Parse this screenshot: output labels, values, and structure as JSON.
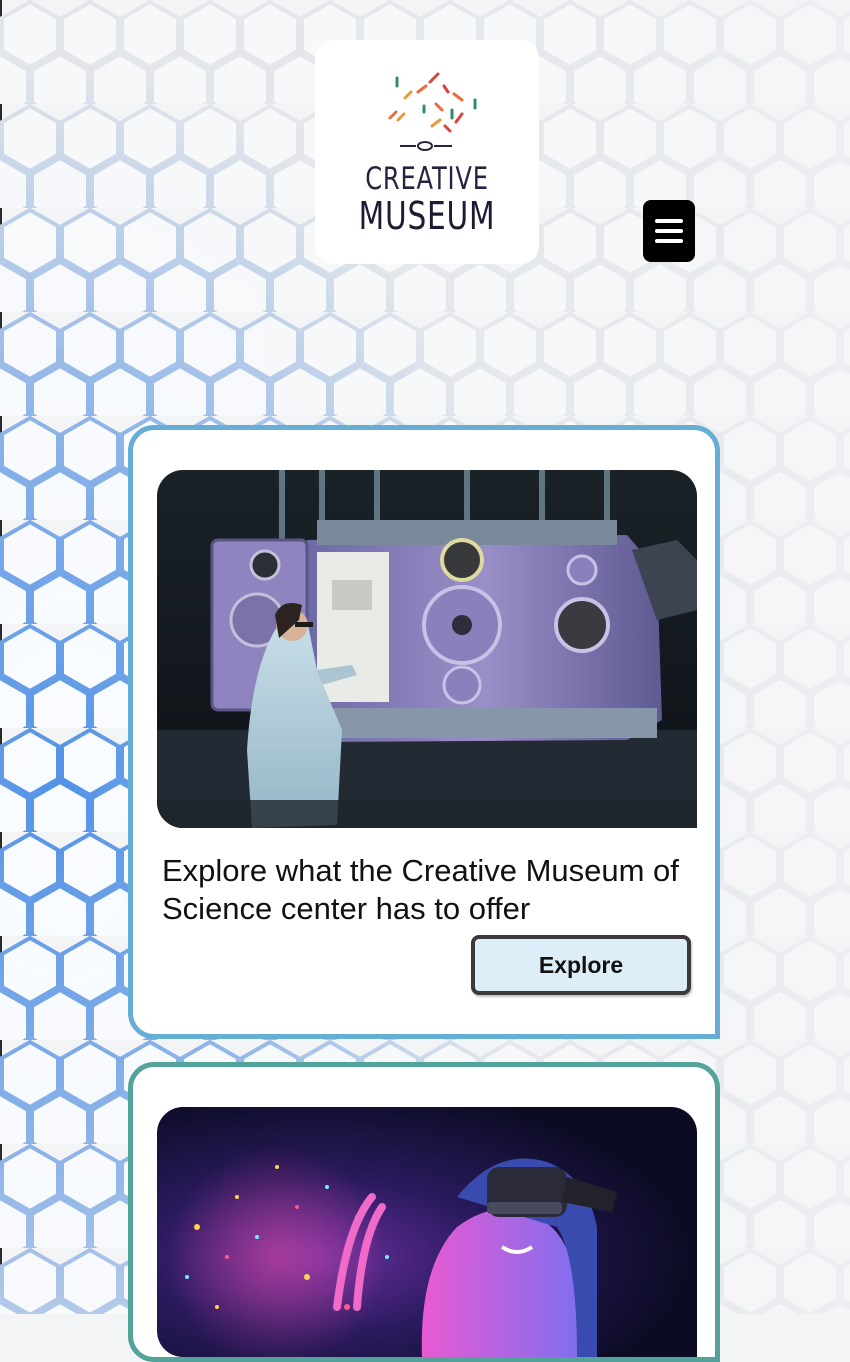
{
  "header": {
    "logo": {
      "line1": "CREATIVE",
      "line2": "MUSEUM",
      "mark_colors": [
        "#2f8b6b",
        "#e86f3c",
        "#d8453a",
        "#e59a3c"
      ]
    },
    "menu_icon": "hamburger-menu-icon"
  },
  "cards": [
    {
      "image": "scientist-with-vacuum-chamber-photo",
      "title": "Explore what the Creative Museum of Science center has to offer",
      "button_label": "Explore",
      "border_color": "#67aed6"
    },
    {
      "image": "person-with-vr-headset-photo",
      "border_color": "#53a39a"
    }
  ],
  "colors": {
    "button_bg": "#deeef8",
    "menu_bg": "#000000"
  }
}
